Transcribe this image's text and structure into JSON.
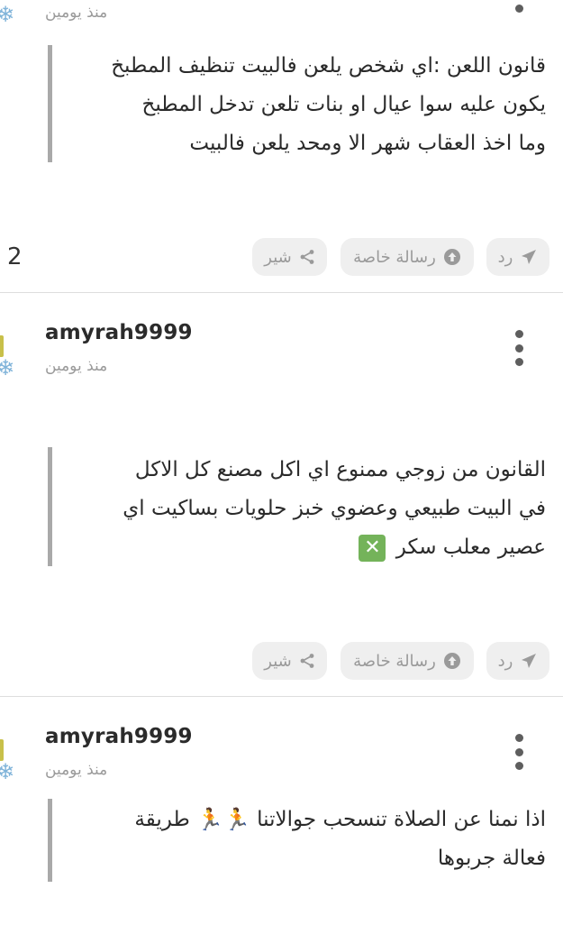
{
  "posts": [
    {
      "time": "منذ يومين",
      "text": "قانون اللعن :اي شخص يلعن فالبيت تنظيف المطبخ\nيكون عليه سوا عيال او بنات تلعن تدخل المطبخ\nوما اخذ العقاب شهر الا ومحد يلعن فالبيت",
      "reply_label": "رد",
      "private_label": "رسالة خاصة",
      "share_label": "شير",
      "counter": "2"
    },
    {
      "username": "amyrah9999",
      "time": "منذ يومين",
      "line1": "القانون من زوجي ممنوع اي اكل مصنع كل الاكل",
      "line2": "في البيت طبيعي وعضوي خبز حلويات بساكيت اي",
      "line3": "عصير معلب سكر",
      "emoji": "✕",
      "reply_label": "رد",
      "private_label": "رسالة خاصة",
      "share_label": "شير"
    },
    {
      "username": "amyrah9999",
      "time": "منذ يومين",
      "line1_a": "اذا نمنا عن الصلاة تنسحب جوالاتنا",
      "line1_b": "طريقة",
      "line2": "فعالة جربوها",
      "runner_emoji": "🏃"
    }
  ]
}
